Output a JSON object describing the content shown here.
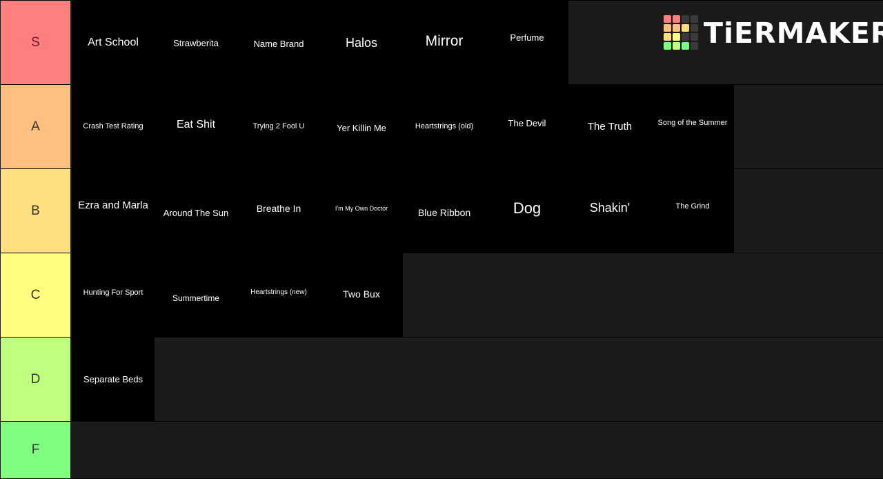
{
  "brand": {
    "logo_text": "TiERMAKER",
    "logo_grid_colors": [
      [
        "#f87f7f",
        "#f87f7f",
        "#3a3a3a",
        "#3a3a3a"
      ],
      [
        "#ffbf7f",
        "#ffbf7f",
        "#ffdf7f",
        "#3a3a3a"
      ],
      [
        "#ffdf7f",
        "#ffff7f",
        "#3a3a3a",
        "#3a3a3a"
      ],
      [
        "#7fff7f",
        "#bfff7f",
        "#7fff7f",
        "#3a3a3a"
      ]
    ]
  },
  "tiers": [
    {
      "label": "S",
      "color": "#ff7f7f",
      "items": [
        "Art School",
        "Strawberita",
        "Name Brand",
        "Halos",
        "Mirror",
        "Perfume"
      ]
    },
    {
      "label": "A",
      "color": "#ffbf7f",
      "items": [
        "Crash Test Rating",
        "Eat Shit",
        "Trying 2 Fool U",
        "Yer Killin Me",
        "Heartstrings (old)",
        "The Devil",
        "The Truth",
        "Song of the Summer"
      ]
    },
    {
      "label": "B",
      "color": "#ffdf7f",
      "items": [
        "Ezra and Marla",
        "Around The Sun",
        "Breathe In",
        "I'm My Own Doctor",
        "Blue Ribbon",
        "Dog",
        "Shakin'",
        "The Grind"
      ]
    },
    {
      "label": "C",
      "color": "#ffff7f",
      "items": [
        "Hunting For Sport",
        "Summertime",
        "Heartstrings (new)",
        "Two Bux"
      ]
    },
    {
      "label": "D",
      "color": "#bfff7f",
      "items": [
        "Separate Beds"
      ]
    },
    {
      "label": "F",
      "color": "#7fff7f",
      "items": []
    }
  ]
}
